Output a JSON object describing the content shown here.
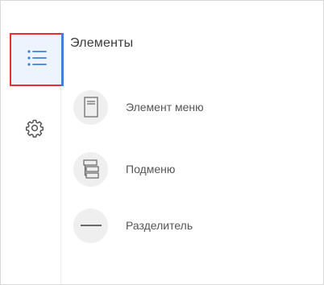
{
  "sidebar": {
    "items": [
      {
        "icon": "list-icon",
        "active": true
      },
      {
        "icon": "gear-icon",
        "active": false
      }
    ],
    "accent_color": "#3f80de",
    "highlight_color": "#e8302f"
  },
  "panel": {
    "title": "Элементы",
    "items": [
      {
        "label": "Элемент меню",
        "icon": "menu-item-icon"
      },
      {
        "label": "Подменю",
        "icon": "submenu-icon"
      },
      {
        "label": "Разделитель",
        "icon": "separator-icon"
      }
    ]
  }
}
